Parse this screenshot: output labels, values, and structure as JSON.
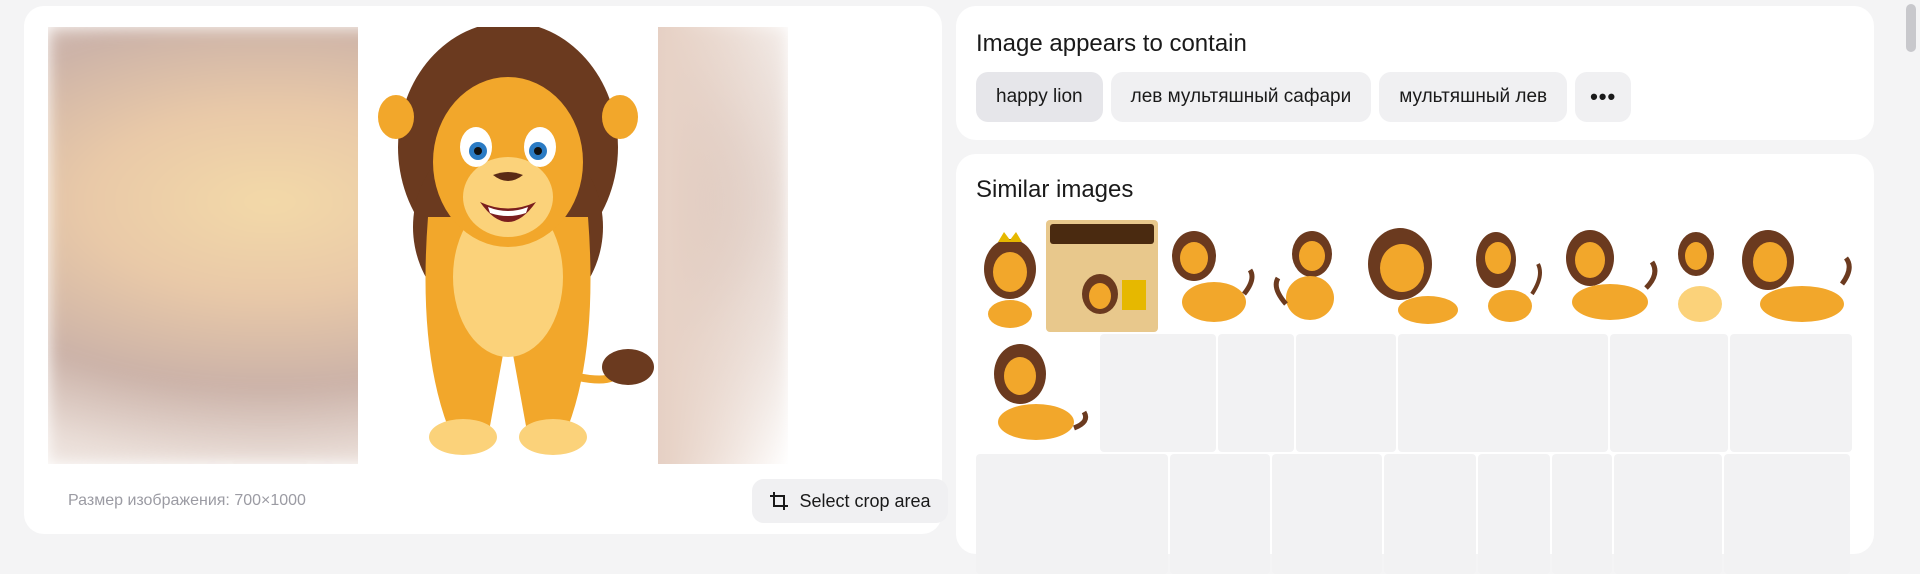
{
  "preview": {
    "size_label": "Размер изображения: 700×1000",
    "crop_button_label": "Select crop area"
  },
  "contains": {
    "title": "Image appears to contain",
    "tags": [
      "happy lion",
      "лев мультяшный сафари",
      "мультяшный лев"
    ],
    "more_label": "•••"
  },
  "similar": {
    "title": "Similar images"
  },
  "colors": {
    "accent_lion": "#f2a72b",
    "mane": "#6b3a1f",
    "card_bg": "#ffffff",
    "page_bg": "#f4f4f5"
  }
}
